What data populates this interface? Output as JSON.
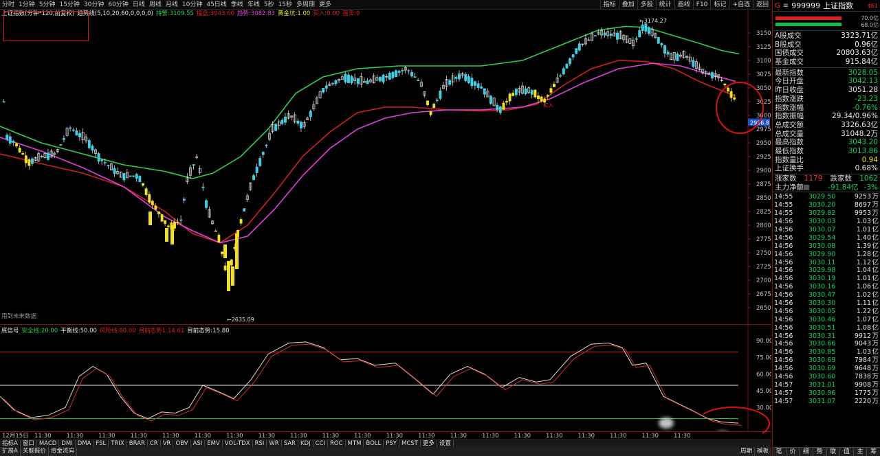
{
  "toolbar": {
    "periods": [
      "分时",
      "1分钟",
      "5分钟",
      "15分钟",
      "30分钟",
      "60分钟",
      "日线",
      "周线",
      "月线",
      "10分钟",
      "45日线",
      "季线",
      "年线",
      "5秒",
      "15秒",
      "多周期",
      "更多"
    ],
    "tools": [
      "指标",
      "叠加",
      "多股",
      "统计",
      "画线",
      "F10",
      "标记",
      "+自选",
      "返回"
    ]
  },
  "main": {
    "title": "上证指数(分钟*120,前复权)",
    "indicator_name": "趋势线(5,10,20,60,0,0,0,0)",
    "support_label": "持警:",
    "support_value": "3109.55",
    "pressure_label": "操盘:",
    "pressure_value": "3043.60",
    "trend_label": "趋势:",
    "trend_value": "3082.83",
    "gold_label": "黄金坑:",
    "gold_value": "1.00",
    "buy_label": "买入:",
    "buy_value": "0.00",
    "sell_label": "强卖:",
    "sell_value": "0",
    "high_annot": "3174.27",
    "low_annot": "2635.09",
    "current_price_tag": "2986.8",
    "buy_annot": "买入",
    "watermark": "用到未来数据",
    "y_ticks": [
      "3150",
      "3125",
      "3100",
      "3075",
      "3050",
      "3025",
      "3000",
      "2975",
      "2950",
      "2925",
      "2900",
      "2875",
      "2850",
      "2825",
      "2800",
      "2775",
      "2750",
      "2725",
      "2700",
      "2675",
      "2650"
    ]
  },
  "sub": {
    "name": "底信号",
    "safe_label": "安全线:",
    "safe_value": "20.00",
    "balance_label": "平衡线:",
    "balance_value": "50.00",
    "risk_label": "风险线:",
    "risk_value": "80.00",
    "cur_label": "目前态势1:",
    "cur_value": "14.61",
    "cur2_label": "目前态势:",
    "cur2_value": "15.80",
    "y_ticks": [
      "90.00",
      "75.00",
      "60.00",
      "45.00",
      "30.00"
    ]
  },
  "time_axis": [
    "12月15日",
    "11:30",
    "11:30",
    "11:30",
    "11:30",
    "11:30",
    "11:30",
    "11:30",
    "11:30",
    "11:30",
    "11:30",
    "11:30",
    "11:30",
    "11:30",
    "11:30",
    "11:30",
    "11:30",
    "11:30",
    "11:30",
    "11:30",
    "11:30",
    "11:30"
  ],
  "indicator_tabs": [
    "指标A",
    "窗口",
    "MACD",
    "DMI",
    "DMA",
    "FSL",
    "TRIX",
    "BRAR",
    "CR",
    "VR",
    "OBV",
    "ASI",
    "EMV",
    "VOL-TDX",
    "RSI",
    "WR",
    "SAR",
    "KDJ",
    "CCI",
    "ROC",
    "MTM",
    "BOLL",
    "PSY",
    "MCST",
    "更多",
    "设置"
  ],
  "bottom_tabs": [
    "扩展A",
    "关联报价",
    "资金流向"
  ],
  "bottom_right_tabs": [
    "周期",
    "模板"
  ],
  "quote": {
    "g": "G",
    "code": "999999",
    "name": "上证指数",
    "badge": "$61",
    "bar1_pct": "70.0亿",
    "bar2_pct": "68.0亿",
    "rows1": [
      {
        "k": "A股成交",
        "v": "3323.71",
        "u": "亿"
      },
      {
        "k": "B股成交",
        "v": "0.96",
        "u": "亿"
      },
      {
        "k": "国债成交",
        "v": "20803.63",
        "u": "亿"
      },
      {
        "k": "基金成交",
        "v": "915.84",
        "u": "亿"
      }
    ],
    "rows2": [
      {
        "k": "最新指数",
        "v": "3028.05",
        "c": "#10d060"
      },
      {
        "k": "今日开盘",
        "v": "3042.13",
        "c": "#10d060"
      },
      {
        "k": "昨日收盘",
        "v": "3051.28",
        "c": "#e8e8e8"
      },
      {
        "k": "指数涨跌",
        "v": "-23.23",
        "c": "#10d060"
      },
      {
        "k": "指数涨幅",
        "v": "-0.76%",
        "c": "#10d060"
      },
      {
        "k": "指数振幅",
        "v": "29.34/0.96%",
        "c": "#e8e8e8"
      },
      {
        "k": "总成交额",
        "v": "3326.63亿",
        "c": "#e8e8e8"
      },
      {
        "k": "总成交量",
        "v": "31048.2万",
        "c": "#e8e8e8"
      },
      {
        "k": "最高指数",
        "v": "3043.20",
        "c": "#10d060"
      },
      {
        "k": "最低指数",
        "v": "3013.86",
        "c": "#10d060"
      },
      {
        "k": "指数量比",
        "v": "0.94",
        "c": "#e8e020"
      },
      {
        "k": "上证换手",
        "v": "0.68%",
        "c": "#e8e8e8"
      }
    ],
    "up_label": "涨家数",
    "up_value": "1179",
    "down_label": "跌家数",
    "down_value": "1062",
    "flow_label": "主力净额",
    "flow_value": "-91.84亿",
    "flow_pct": "-3%",
    "ticks": [
      {
        "t": "14:55",
        "p": "3029.50",
        "v": "9253",
        "u": "万"
      },
      {
        "t": "14:55",
        "p": "3030.20",
        "v": "8697",
        "u": "万"
      },
      {
        "t": "14:55",
        "p": "3029.82",
        "v": "9953",
        "u": "万"
      },
      {
        "t": "14:56",
        "p": "3030.03",
        "v": "1.03",
        "u": "亿"
      },
      {
        "t": "14:56",
        "p": "3030.07",
        "v": "1.01",
        "u": "亿"
      },
      {
        "t": "14:56",
        "p": "3029.54",
        "v": "1.40",
        "u": "亿"
      },
      {
        "t": "14:56",
        "p": "3030.08",
        "v": "1.39",
        "u": "亿"
      },
      {
        "t": "14:56",
        "p": "3029.90",
        "v": "1.28",
        "u": "亿"
      },
      {
        "t": "14:56",
        "p": "3030.11",
        "v": "1.12",
        "u": "亿"
      },
      {
        "t": "14:56",
        "p": "3029.98",
        "v": "1.04",
        "u": "亿"
      },
      {
        "t": "14:56",
        "p": "3030.19",
        "v": "1.01",
        "u": "亿"
      },
      {
        "t": "14:56",
        "p": "3030.16",
        "v": "1.06",
        "u": "亿"
      },
      {
        "t": "14:56",
        "p": "3030.47",
        "v": "1.02",
        "u": "亿"
      },
      {
        "t": "14:56",
        "p": "3030.30",
        "v": "1.11",
        "u": "亿"
      },
      {
        "t": "14:56",
        "p": "3030.05",
        "v": "1.22",
        "u": "亿"
      },
      {
        "t": "14:56",
        "p": "3030.46",
        "v": "1.07",
        "u": "亿"
      },
      {
        "t": "14:56",
        "p": "3030.51",
        "v": "1.08",
        "u": "亿"
      },
      {
        "t": "14:56",
        "p": "3030.31",
        "v": "9912",
        "u": "万"
      },
      {
        "t": "14:56",
        "p": "3030.66",
        "v": "9043",
        "u": "万"
      },
      {
        "t": "14:56",
        "p": "3030.85",
        "v": "1.03",
        "u": "亿"
      },
      {
        "t": "14:56",
        "p": "3030.69",
        "v": "7984",
        "u": "万"
      },
      {
        "t": "14:56",
        "p": "3030.69",
        "v": "9648",
        "u": "万"
      },
      {
        "t": "14:56",
        "p": "3030.60",
        "v": "7838",
        "u": "万"
      },
      {
        "t": "14:57",
        "p": "3031.01",
        "v": "9908",
        "u": "万"
      },
      {
        "t": "14:57",
        "p": "3030.96",
        "v": "1775",
        "u": "万"
      },
      {
        "t": "14:57",
        "p": "3031.07",
        "v": "2220",
        "u": "万"
      }
    ],
    "bottom_tabs": [
      "笔",
      "价",
      "细",
      "势",
      "联",
      "值",
      "主",
      "筹"
    ]
  },
  "colors": {
    "up": "#3ad0e8",
    "down": "#f0e020",
    "green_line": "#2ed050",
    "red_line": "#d02020",
    "magenta_line": "#e040e0",
    "accent_red": "#e01010"
  }
}
